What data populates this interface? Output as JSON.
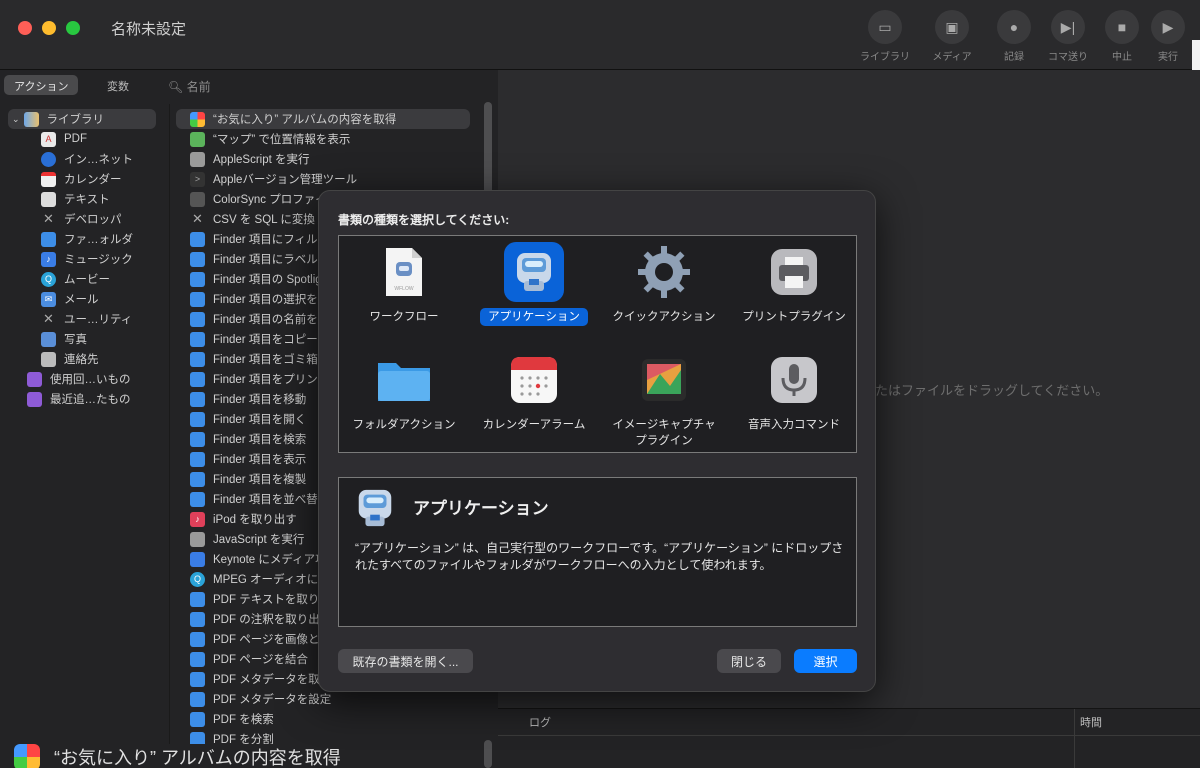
{
  "window": {
    "title": "名称未設定"
  },
  "toolbar": [
    {
      "label": "ライブラリ",
      "icon": "sidebar-icon"
    },
    {
      "label": "メディア",
      "icon": "photo-icon"
    },
    {
      "label": "記録",
      "icon": "record-icon"
    },
    {
      "label": "コマ送り",
      "icon": "step-icon"
    },
    {
      "label": "中止",
      "icon": "stop-icon"
    },
    {
      "label": "実行",
      "icon": "play-icon"
    }
  ],
  "left_tabs": {
    "actions": "アクション",
    "variables": "変数",
    "search_placeholder": "名前"
  },
  "library": [
    "ライブラリ",
    "PDF",
    "イン…ネット",
    "カレンダー",
    "テキスト",
    "デベロッパ",
    "ファ…ォルダ",
    "ミュージック",
    "ムービー",
    "メール",
    "ユー…リティ",
    "写真",
    "連絡先",
    "使用回…いもの",
    "最近追…たもの"
  ],
  "actions": [
    "“お気に入り” アルバムの内容を取得",
    "“マップ” で位置情報を表示",
    "AppleScript を実行",
    "Appleバージョン管理ツール",
    "ColorSync プロファイル",
    "CSV を SQL に変換",
    "Finder 項目にフィルタ",
    "Finder 項目にラベルを",
    "Finder 項目の Spotlig",
    "Finder 項目の選択を求",
    "Finder 項目の名前を変",
    "Finder 項目をコピー",
    "Finder 項目をゴミ箱に",
    "Finder 項目をプリント",
    "Finder 項目を移動",
    "Finder 項目を開く",
    "Finder 項目を検索",
    "Finder 項目を表示",
    "Finder 項目を複製",
    "Finder 項目を並べ替え",
    "iPod を取り出す",
    "JavaScript を実行",
    "Keynote にメディア項",
    "MPEG オーディオにエ",
    "PDF テキストを取り出",
    "PDF の注釈を取り出す",
    "PDF ページを画像とし",
    "PDF ページを結合",
    "PDF メタデータを取得",
    "PDF メタデータを設定",
    "PDF を検索",
    "PDF を分割"
  ],
  "bottom_description": "“お気に入り” アルバムの内容を取得",
  "workflow": {
    "drop_hint": "たはファイルをドラッグしてください。"
  },
  "log": {
    "log_label": "ログ",
    "time_label": "時間"
  },
  "modal": {
    "prompt": "書類の種類を選択してください:",
    "types": [
      {
        "name": "ワークフロー"
      },
      {
        "name": "アプリケーション"
      },
      {
        "name": "クイックアクション"
      },
      {
        "name": "プリントプラグイン"
      },
      {
        "name": "フォルダアクション"
      },
      {
        "name": "カレンダーアラーム"
      },
      {
        "name": "イメージキャプチャ プラグイン"
      },
      {
        "name": "音声入力コマンド"
      }
    ],
    "selected_index": 1,
    "workflow_file_label": "WFLOW",
    "desc_title": "アプリケーション",
    "desc_text": "“アプリケーション” は、自己実行型のワークフローです。“アプリケーション” にドロップされたすべてのファイルやフォルダがワークフローへの入力として使われます。",
    "buttons": {
      "open_existing": "既存の書類を開く...",
      "close": "閉じる",
      "choose": "選択"
    }
  },
  "colors": {
    "accent": "#0a7cff",
    "selection": "#0a63d8"
  }
}
